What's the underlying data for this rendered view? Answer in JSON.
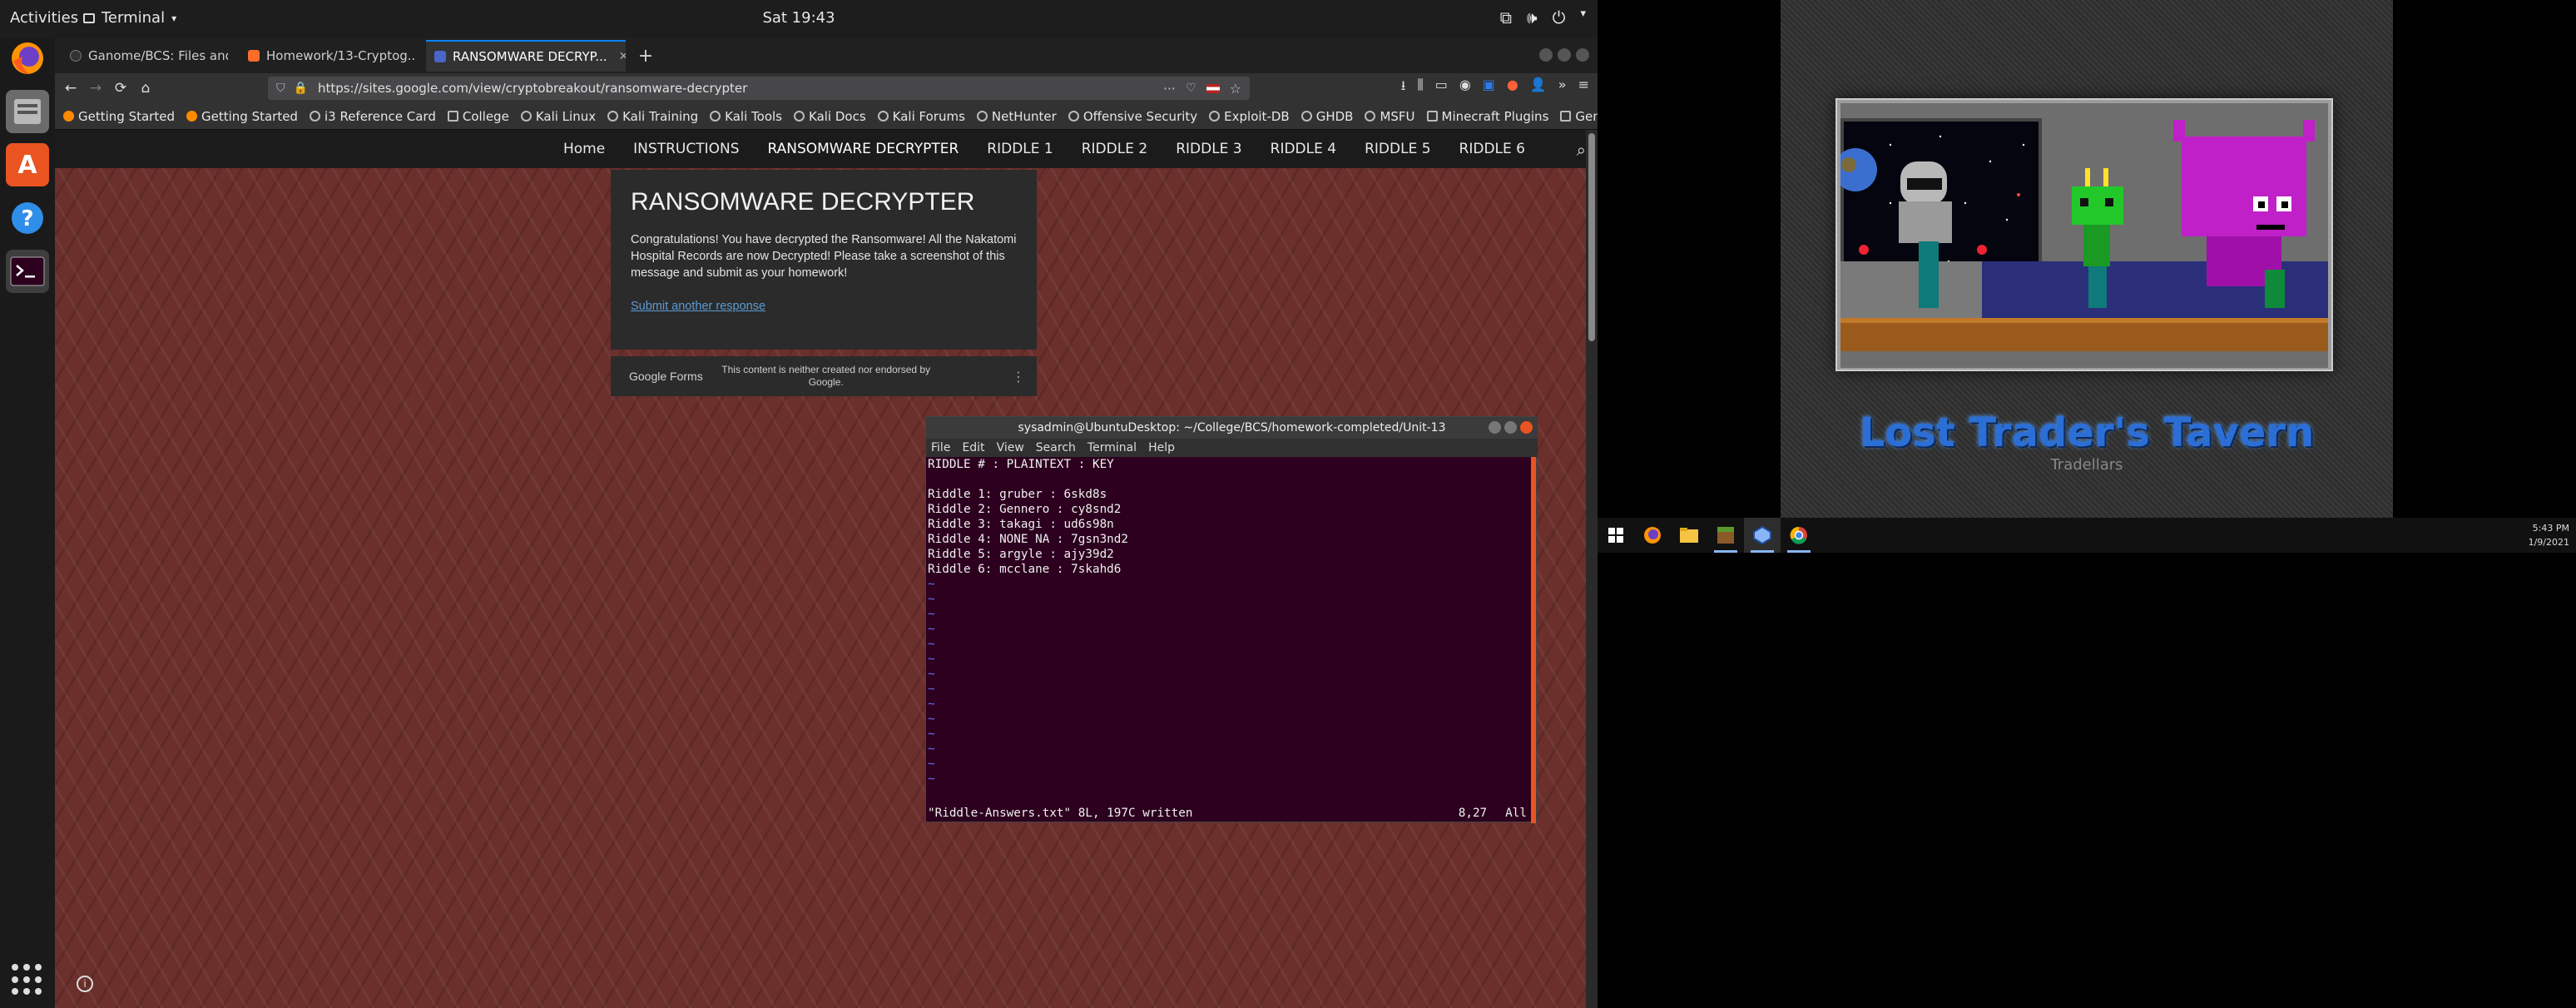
{
  "topbar": {
    "activities": "Activities",
    "app_menu": "Terminal",
    "clock": "Sat 19:43"
  },
  "browser": {
    "tabs": [
      {
        "label": "Ganome/BCS: Files and ...",
        "active": false
      },
      {
        "label": "Homework/13-Cryptog...",
        "active": false
      },
      {
        "label": "RANSOMWARE DECRYP...",
        "active": true
      }
    ],
    "url": "https://sites.google.com/view/cryptobreakout/ransomware-decrypter",
    "bookmarks": [
      "Getting Started",
      "Getting Started",
      "i3 Reference Card",
      "College",
      "Kali Linux",
      "Kali Training",
      "Kali Tools",
      "Kali Docs",
      "Kali Forums",
      "NetHunter",
      "Offensive Security",
      "Exploit-DB",
      "GHDB",
      "MSFU",
      "Minecraft Plugins",
      "Gentoo"
    ]
  },
  "site": {
    "nav": [
      "Home",
      "INSTRUCTIONS",
      "RANSOMWARE DECRYPTER",
      "RIDDLE 1",
      "RIDDLE 2",
      "RIDDLE 3",
      "RIDDLE 4",
      "RIDDLE 5",
      "RIDDLE 6"
    ],
    "card_title": "RANSOMWARE DECRYPTER",
    "card_text": "Congratulations!  You have decrypted the Ransomware!  All the Nakatomi Hospital Records are now Decrypted!  Please take a screenshot of this message and submit as your homework!",
    "card_link": "Submit another response",
    "forms_brand": "Google Forms",
    "forms_disclaimer": "This content is neither created nor endorsed by Google."
  },
  "terminal": {
    "title": "sysadmin@UbuntuDesktop: ~/College/BCS/homework-completed/Unit-13",
    "menu": [
      "File",
      "Edit",
      "View",
      "Search",
      "Terminal",
      "Help"
    ],
    "lines": [
      "RIDDLE # : PLAINTEXT : KEY",
      "",
      "Riddle 1: gruber : 6skd8s",
      "Riddle 2: Gennero : cy8snd2",
      "Riddle 3: takagi : ud6s98n",
      "Riddle 4: NONE NA : 7gsn3nd2",
      "Riddle 5: argyle : ajy39d2",
      "Riddle 6: mcclane : 7skahd6"
    ],
    "tilde_count": 14,
    "status_left": "\"Riddle-Answers.txt\" 8L, 197C written",
    "status_pos": "8,27",
    "status_all": "All"
  },
  "vm": {
    "game_title": "Lost Trader's Tavern",
    "game_subtitle": "Tradellars",
    "time": "5:43 PM",
    "date": "1/9/2021"
  }
}
